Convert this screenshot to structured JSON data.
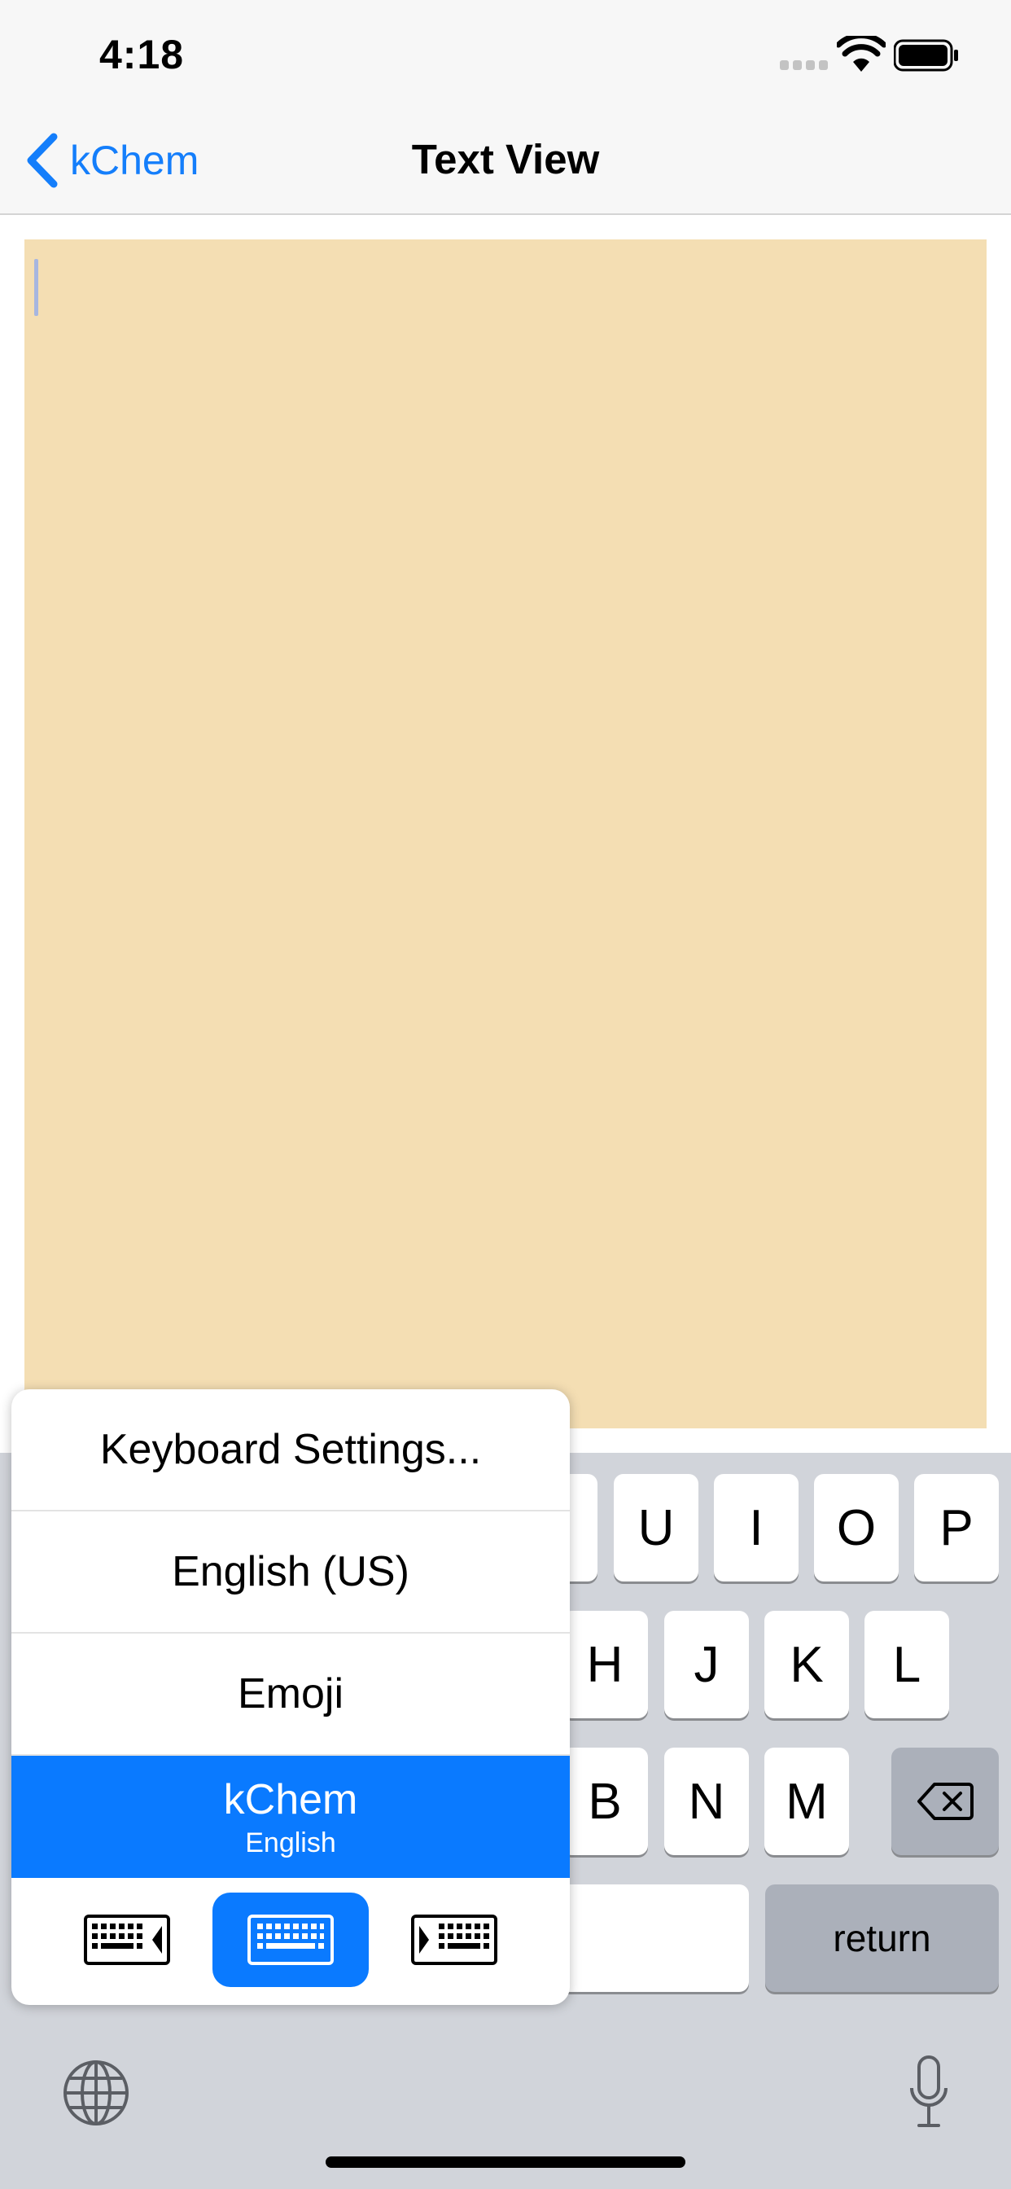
{
  "status_bar": {
    "time": "4:18"
  },
  "nav": {
    "back_label": "kChem",
    "title": "Text View"
  },
  "keyboard": {
    "row1": [
      "U",
      "I",
      "O",
      "P"
    ],
    "row2": [
      "H",
      "J",
      "K",
      "L"
    ],
    "row3": [
      "B",
      "N",
      "M"
    ],
    "return_label": "return"
  },
  "popup": {
    "items": [
      {
        "label": "Keyboard Settings..."
      },
      {
        "label": "English (US)"
      },
      {
        "label": "Emoji"
      },
      {
        "label": "kChem",
        "sublabel": "English"
      }
    ],
    "layouts": [
      "keyboard-left-icon",
      "keyboard-full-icon",
      "keyboard-right-icon"
    ],
    "accent_color": "#0a7aff"
  },
  "colors": {
    "text_view_bg": "#f4deb3",
    "link": "#147efb",
    "keyboard_bg": "#d1d4da"
  }
}
